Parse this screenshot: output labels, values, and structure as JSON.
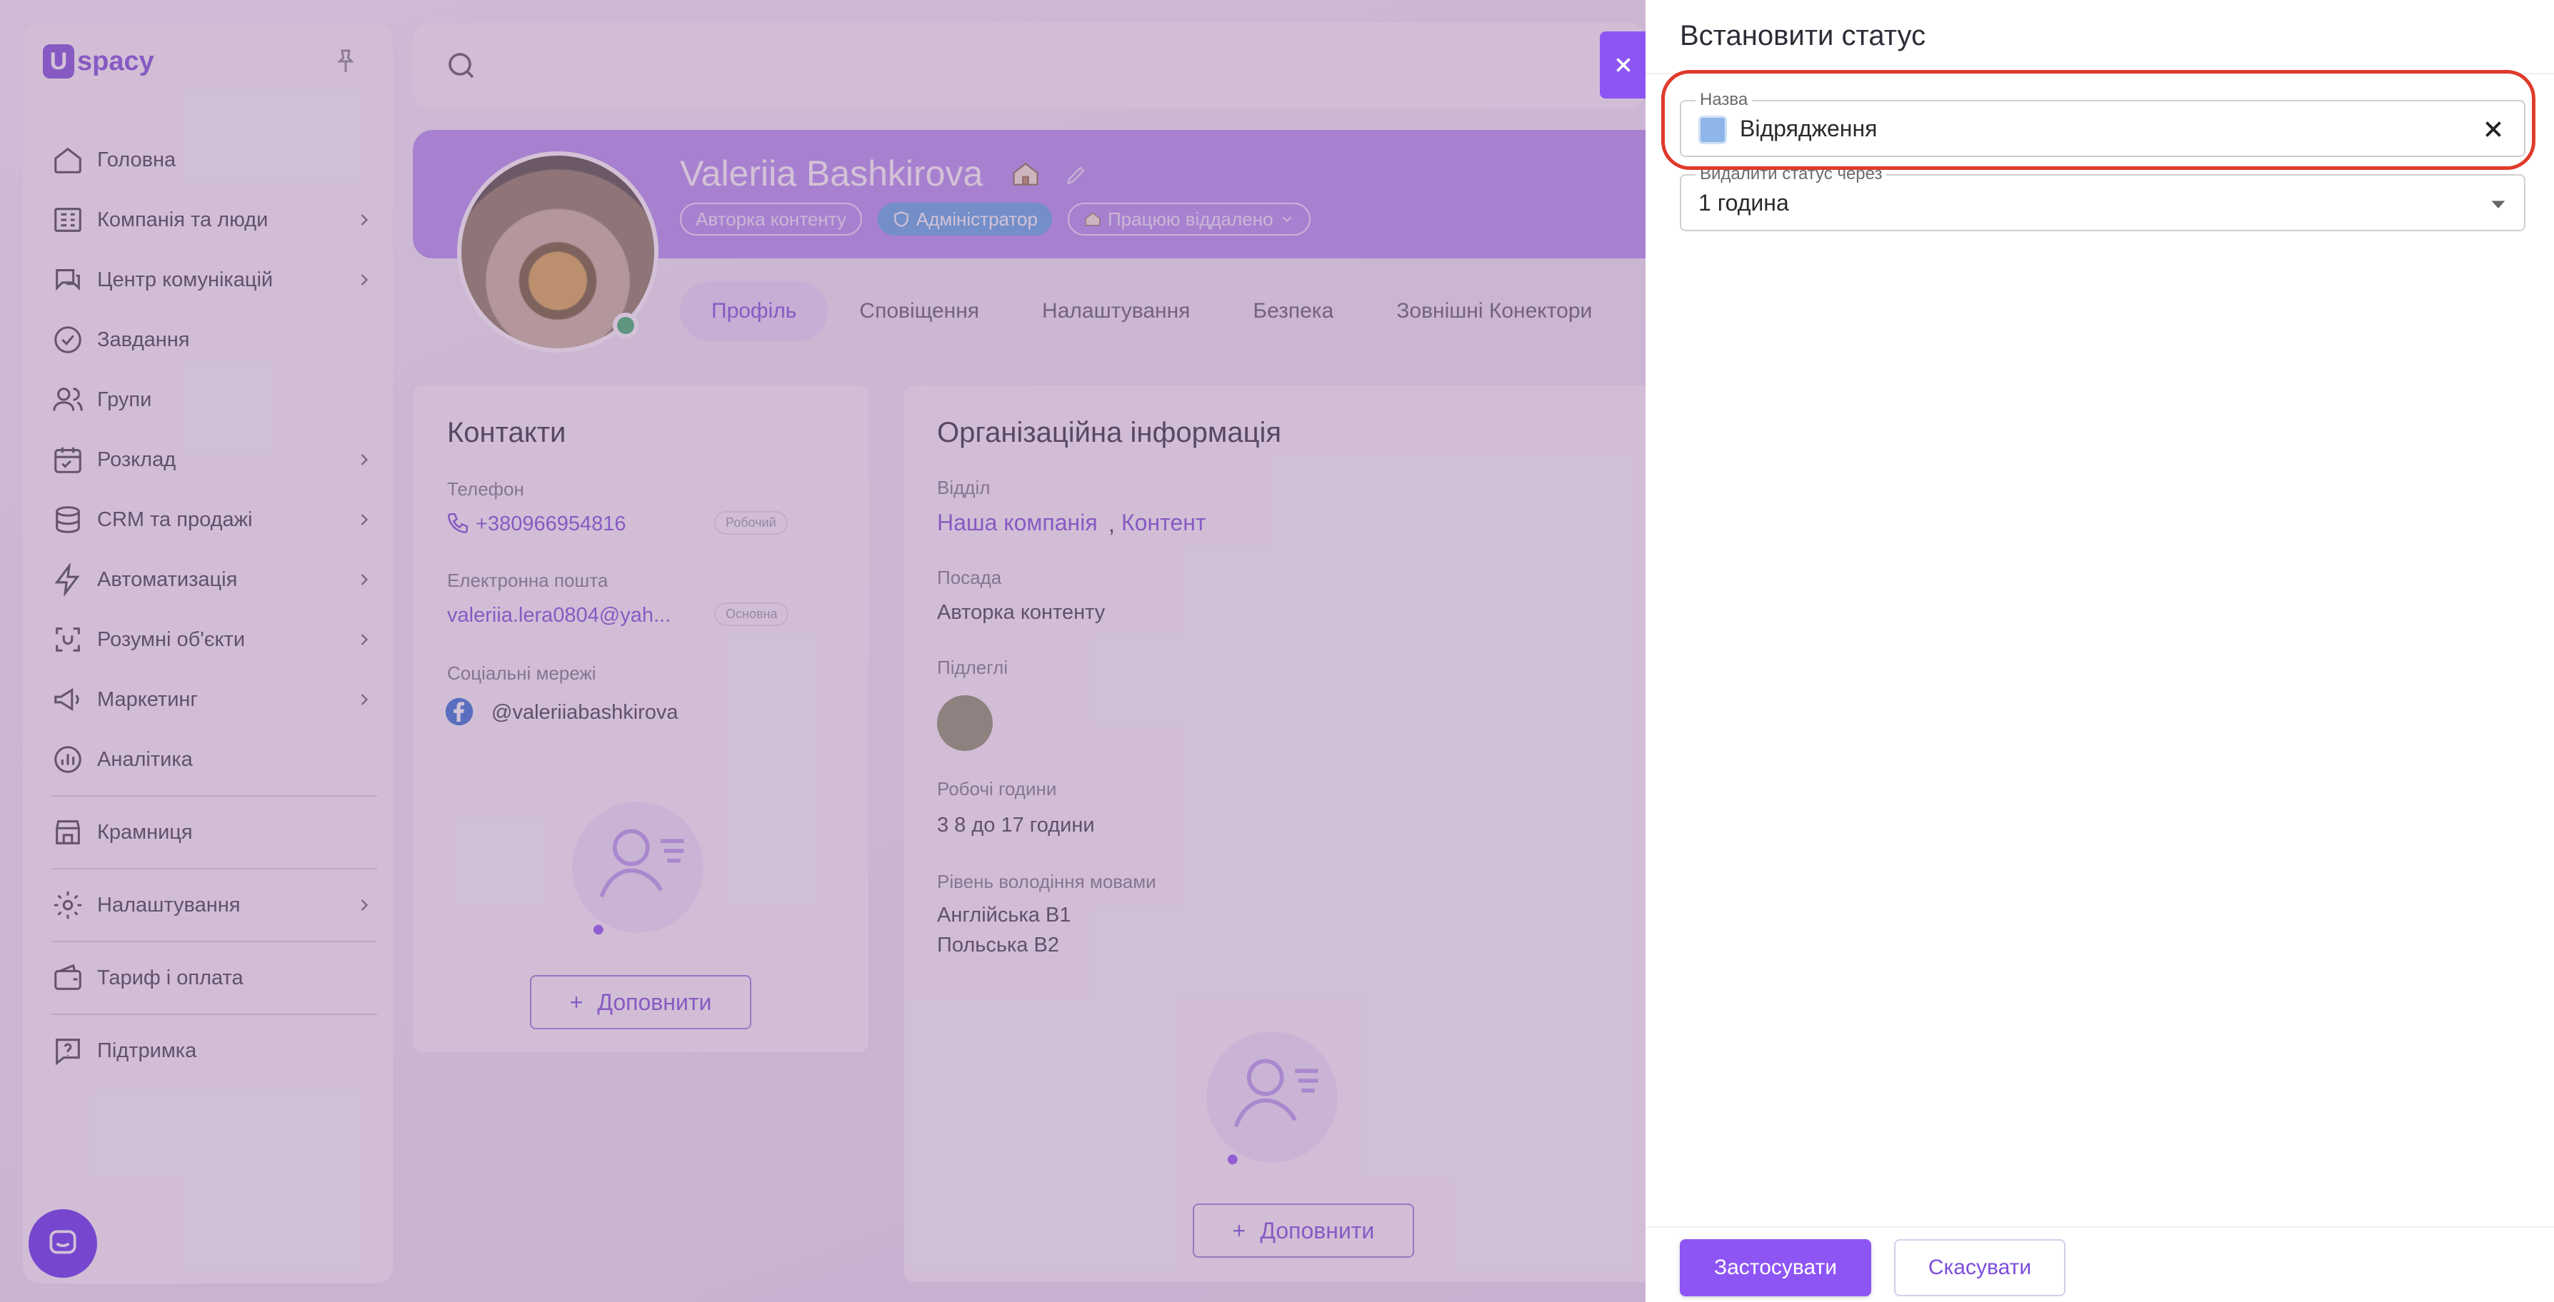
{
  "app": {
    "logo_text": "spacy",
    "logo_mark": "U",
    "search_placeholder": "",
    "sidebar": {
      "items": [
        {
          "label": "Головна",
          "icon": "home-icon",
          "has_submenu": false
        },
        {
          "label": "Компанія та люди",
          "icon": "company-icon",
          "has_submenu": true
        },
        {
          "label": "Центр комунікацій",
          "icon": "chat-icon",
          "has_submenu": true
        },
        {
          "label": "Завдання",
          "icon": "check-circle-icon",
          "has_submenu": false
        },
        {
          "label": "Групи",
          "icon": "users-icon",
          "has_submenu": false
        },
        {
          "label": "Розклад",
          "icon": "calendar-icon",
          "has_submenu": true
        },
        {
          "label": "CRM та продажі",
          "icon": "database-icon",
          "has_submenu": true
        },
        {
          "label": "Автоматизація",
          "icon": "bolt-icon",
          "has_submenu": true
        },
        {
          "label": "Розумні об'єкти",
          "icon": "smart-object-icon",
          "has_submenu": true
        },
        {
          "label": "Маркетинг",
          "icon": "megaphone-icon",
          "has_submenu": true
        },
        {
          "label": "Аналітика",
          "icon": "analytics-icon",
          "has_submenu": false
        }
      ],
      "store": {
        "label": "Крамниця",
        "icon": "store-icon"
      },
      "settings": {
        "label": "Налаштування",
        "icon": "gear-icon"
      },
      "tariff": {
        "label": "Тариф і оплата",
        "icon": "wallet-icon"
      },
      "support": {
        "label": "Підтримка",
        "icon": "help-icon"
      }
    },
    "profile": {
      "name": "Valeriia Bashkirova",
      "badges": {
        "role": "Авторка контенту",
        "admin": "Адміністратор",
        "work_status": "Працюю віддалено"
      },
      "tabs": [
        "Профіль",
        "Сповіщення",
        "Налаштування",
        "Безпека",
        "Зовнішні Конектори"
      ],
      "active_tab": "Профіль"
    },
    "contacts": {
      "title": "Контакти",
      "phone_label": "Телефон",
      "phone": "+380966954816",
      "phone_tag": "Робочий",
      "email_label": "Електронна пошта",
      "email": "valeriia.lera0804@yah...",
      "email_tag": "Основна",
      "social_label": "Соціальні мережі",
      "social": "@valeriiabashkirova",
      "fill_button": "Доповнити"
    },
    "org": {
      "title": "Організаційна інформація",
      "dept_label": "Відділ",
      "dept_company": "Наша компанія",
      "dept_sep": ",",
      "dept_team": "Контент",
      "position_label": "Посада",
      "position": "Авторка контенту",
      "subordinates_label": "Підлеглі",
      "hours_label": "Робочі години",
      "hours": "3 8 до 17 години",
      "lang_label": "Рівень володіння мовами",
      "lang_1": "Англійська B1",
      "lang_2": "Польська B2",
      "fill_button": "Доповнити"
    }
  },
  "drawer": {
    "title": "Встановити статус",
    "name_field": {
      "label": "Назва",
      "value": "Відрядження",
      "emoji": "business-trip-icon"
    },
    "remove_field": {
      "label": "Видалити статус через",
      "value": "1 година"
    },
    "apply_button": "Застосувати",
    "cancel_button": "Скасувати"
  },
  "colors": {
    "accent": "#8e55f5",
    "highlight": "#e03a2c",
    "online": "#36b36a"
  }
}
